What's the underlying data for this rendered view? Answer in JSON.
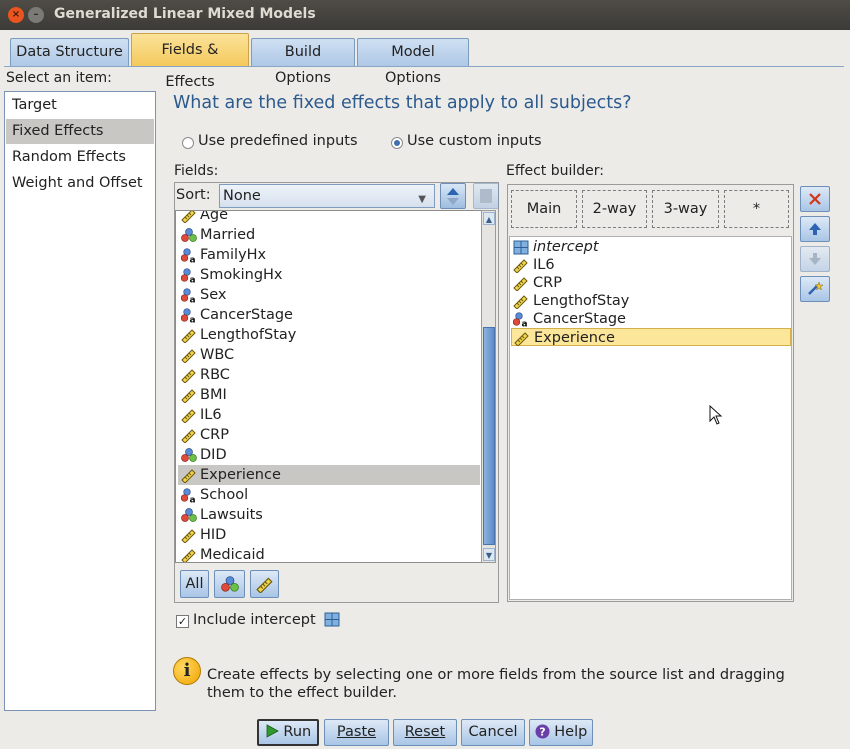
{
  "window": {
    "title": "Generalized Linear Mixed Models"
  },
  "tabs": [
    {
      "label": "Data Structure"
    },
    {
      "label": "Fields & Effects"
    },
    {
      "label": "Build Options"
    },
    {
      "label": "Model Options"
    }
  ],
  "sidebar": {
    "heading": "Select an item:",
    "items": [
      {
        "label": "Target"
      },
      {
        "label": "Fixed Effects"
      },
      {
        "label": "Random Effects"
      },
      {
        "label": "Weight and Offset"
      }
    ]
  },
  "main": {
    "question": "What are the fixed effects that apply to all subjects?",
    "radio_predefined": "Use predefined inputs",
    "radio_custom": "Use custom inputs",
    "fields_label": "Fields:",
    "sort_label": "Sort:",
    "sort_value": "None",
    "fields": [
      {
        "label": "Age",
        "icon": "scale-ruler-icon"
      },
      {
        "label": "Married",
        "icon": "nominal-icon"
      },
      {
        "label": "FamilyHx",
        "icon": "nominal-string-icon"
      },
      {
        "label": "SmokingHx",
        "icon": "nominal-string-icon"
      },
      {
        "label": "Sex",
        "icon": "nominal-string-icon"
      },
      {
        "label": "CancerStage",
        "icon": "ordinal-string-icon"
      },
      {
        "label": "LengthofStay",
        "icon": "scale-ruler-icon"
      },
      {
        "label": "WBC",
        "icon": "scale-ruler-icon"
      },
      {
        "label": "RBC",
        "icon": "scale-ruler-icon"
      },
      {
        "label": "BMI",
        "icon": "scale-ruler-icon"
      },
      {
        "label": "IL6",
        "icon": "scale-ruler-icon"
      },
      {
        "label": "CRP",
        "icon": "scale-ruler-icon"
      },
      {
        "label": "DID",
        "icon": "nominal-icon"
      },
      {
        "label": "Experience",
        "icon": "scale-ruler-icon"
      },
      {
        "label": "School",
        "icon": "nominal-string-icon"
      },
      {
        "label": "Lawsuits",
        "icon": "nominal-icon"
      },
      {
        "label": "HID",
        "icon": "scale-ruler-icon"
      },
      {
        "label": "Medicaid",
        "icon": "scale-ruler-icon"
      }
    ],
    "field_buttons": {
      "all": "All"
    },
    "effect_builder_label": "Effect builder:",
    "effect_tabs": [
      "Main",
      "2-way",
      "3-way",
      "*"
    ],
    "effects": [
      {
        "label": "intercept",
        "icon": "intercept-icon"
      },
      {
        "label": "IL6",
        "icon": "scale-ruler-icon"
      },
      {
        "label": "CRP",
        "icon": "scale-ruler-icon"
      },
      {
        "label": "LengthofStay",
        "icon": "scale-ruler-icon"
      },
      {
        "label": "CancerStage",
        "icon": "ordinal-string-icon"
      },
      {
        "label": "Experience",
        "icon": "scale-ruler-icon"
      }
    ],
    "include_intercept": "Include intercept",
    "info_text": "Create effects by selecting one or more fields from the source list and dragging them to the effect builder."
  },
  "footer": {
    "run": "Run",
    "paste": "Paste",
    "reset": "Reset",
    "cancel": "Cancel",
    "help": "Help"
  }
}
